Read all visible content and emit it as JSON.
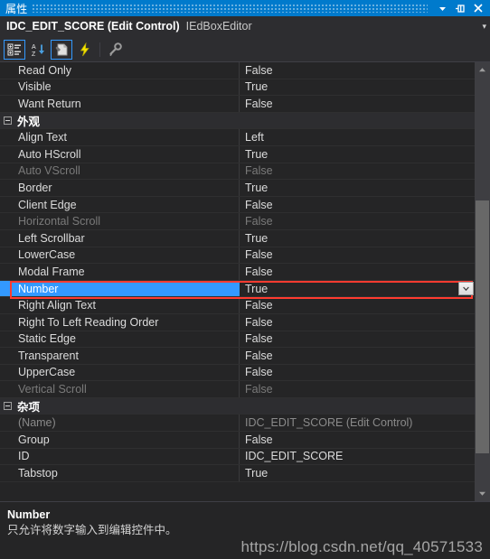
{
  "titlebar": {
    "title": "属性",
    "buttons": [
      {
        "name": "window-dropdown-button",
        "icon": "chevron-down-icon"
      },
      {
        "name": "auto-hide-pin-button",
        "icon": "pin-icon"
      },
      {
        "name": "close-button",
        "icon": "close-icon"
      }
    ]
  },
  "object_header": {
    "name": "IDC_EDIT_SCORE (Edit Control)",
    "editor": "IEdBoxEditor",
    "caret": "▾"
  },
  "toolbar": {
    "buttons": [
      {
        "name": "categorized-view-button",
        "icon": "categorized-icon",
        "active": true,
        "title": "分类"
      },
      {
        "name": "alphabetical-view-button",
        "icon": "alphabetical-sort-icon",
        "active": false,
        "title": "按字母顺序"
      },
      {
        "name": "property-pages-button",
        "icon": "property-pages-icon",
        "active": true,
        "title": "属性页"
      },
      {
        "name": "events-button",
        "icon": "lightning-bolt-icon",
        "active": false,
        "title": "事件"
      },
      {
        "name": "messages-button",
        "icon": "key-icon",
        "active": false,
        "title": "消息"
      }
    ]
  },
  "grid": {
    "rows": [
      {
        "type": "property",
        "name": "Read Only",
        "value": "False",
        "state": "normal"
      },
      {
        "type": "property",
        "name": "Visible",
        "value": "True",
        "state": "normal"
      },
      {
        "type": "property",
        "name": "Want Return",
        "value": "False",
        "state": "normal"
      },
      {
        "type": "category",
        "name": "外观"
      },
      {
        "type": "property",
        "name": "Align Text",
        "value": "Left",
        "state": "normal"
      },
      {
        "type": "property",
        "name": "Auto HScroll",
        "value": "True",
        "state": "normal"
      },
      {
        "type": "property",
        "name": "Auto VScroll",
        "value": "False",
        "state": "disabled"
      },
      {
        "type": "property",
        "name": "Border",
        "value": "True",
        "state": "normal"
      },
      {
        "type": "property",
        "name": "Client Edge",
        "value": "False",
        "state": "normal"
      },
      {
        "type": "property",
        "name": "Horizontal Scroll",
        "value": "False",
        "state": "disabled"
      },
      {
        "type": "property",
        "name": "Left Scrollbar",
        "value": "True",
        "state": "normal"
      },
      {
        "type": "property",
        "name": "LowerCase",
        "value": "False",
        "state": "normal"
      },
      {
        "type": "property",
        "name": "Modal Frame",
        "value": "False",
        "state": "normal"
      },
      {
        "type": "property",
        "name": "Number",
        "value": "True",
        "state": "selected"
      },
      {
        "type": "property",
        "name": "Right Align Text",
        "value": "False",
        "state": "normal"
      },
      {
        "type": "property",
        "name": "Right To Left Reading Order",
        "value": "False",
        "state": "normal"
      },
      {
        "type": "property",
        "name": "Static Edge",
        "value": "False",
        "state": "normal"
      },
      {
        "type": "property",
        "name": "Transparent",
        "value": "False",
        "state": "normal"
      },
      {
        "type": "property",
        "name": "UpperCase",
        "value": "False",
        "state": "normal"
      },
      {
        "type": "property",
        "name": "Vertical Scroll",
        "value": "False",
        "state": "disabled"
      },
      {
        "type": "category",
        "name": "杂项"
      },
      {
        "type": "property",
        "name": "(Name)",
        "value": "IDC_EDIT_SCORE (Edit Control)",
        "state": "readonly"
      },
      {
        "type": "property",
        "name": "Group",
        "value": "False",
        "state": "normal"
      },
      {
        "type": "property",
        "name": "ID",
        "value": "IDC_EDIT_SCORE",
        "state": "normal"
      },
      {
        "type": "property",
        "name": "Tabstop",
        "value": "True",
        "state": "normal"
      }
    ],
    "selected_row_index": 13,
    "dropdown_icon": "chevron-down-icon"
  },
  "scrollbar": {
    "up_arrow": "scroll-up-arrow-icon",
    "down_arrow": "scroll-down-arrow-icon",
    "thumb_top_pct": 30,
    "thumb_height_pct": 62
  },
  "description": {
    "title": "Number",
    "text": "只允许将数字输入到编辑控件中。"
  },
  "watermark": {
    "text": "https://blog.csdn.net/qq_40571533"
  },
  "colors": {
    "accent": "#007acc",
    "selection": "#3399ff",
    "highlight_outline": "#ff3b30",
    "panel_bg": "#252526",
    "chrome_bg": "#2d2d30"
  }
}
